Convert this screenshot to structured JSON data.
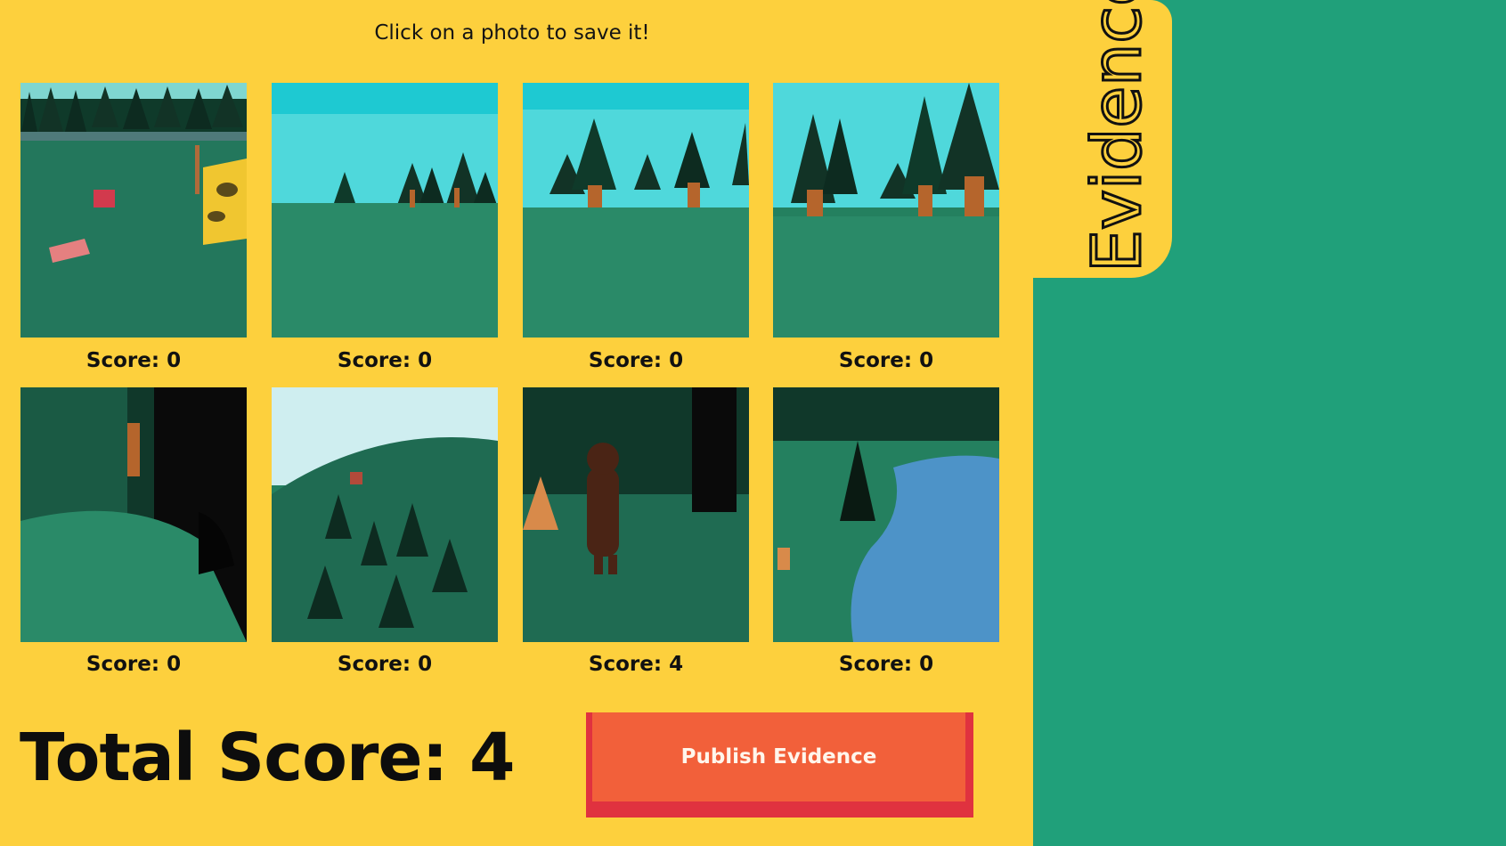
{
  "instruction": "Click on a photo to save it!",
  "tab_label": "Evidence",
  "photos": [
    {
      "scene": "meadow with picnic items and sign",
      "score_label": "Score: 0"
    },
    {
      "scene": "forest edge under sky",
      "score_label": "Score: 0"
    },
    {
      "scene": "pine trees",
      "score_label": "Score: 0"
    },
    {
      "scene": "tall pine trees",
      "score_label": "Score: 0"
    },
    {
      "scene": "dark close-up of foliage",
      "score_label": "Score: 0"
    },
    {
      "scene": "hillside forest",
      "score_label": "Score: 0"
    },
    {
      "scene": "figure among trees",
      "score_label": "Score: 4"
    },
    {
      "scene": "pond in forest",
      "score_label": "Score: 0"
    }
  ],
  "total_score_label": "Total Score: 4",
  "publish_label": "Publish Evidence",
  "colors": {
    "panel": "#fdd03d",
    "background": "#20a07a",
    "button": "#f2603a",
    "button_shadow": "#e0323f"
  }
}
